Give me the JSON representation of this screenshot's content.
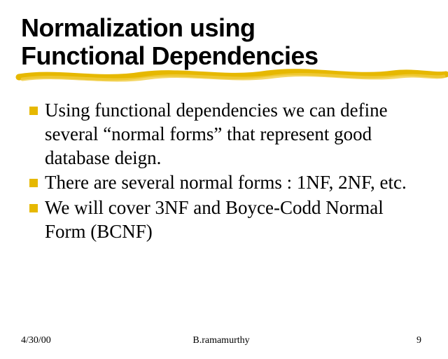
{
  "title_line1": "Normalization using",
  "title_line2": "Functional Dependencies",
  "bullets": [
    "Using functional dependencies we can define several “normal forms” that represent good database deign.",
    "There are several normal forms : 1NF, 2NF, etc.",
    "We will cover 3NF and Boyce-Codd Normal Form (BCNF)"
  ],
  "footer": {
    "date": "4/30/00",
    "author": "B.ramamurthy",
    "page": "9"
  },
  "colors": {
    "accent": "#e6b800"
  }
}
